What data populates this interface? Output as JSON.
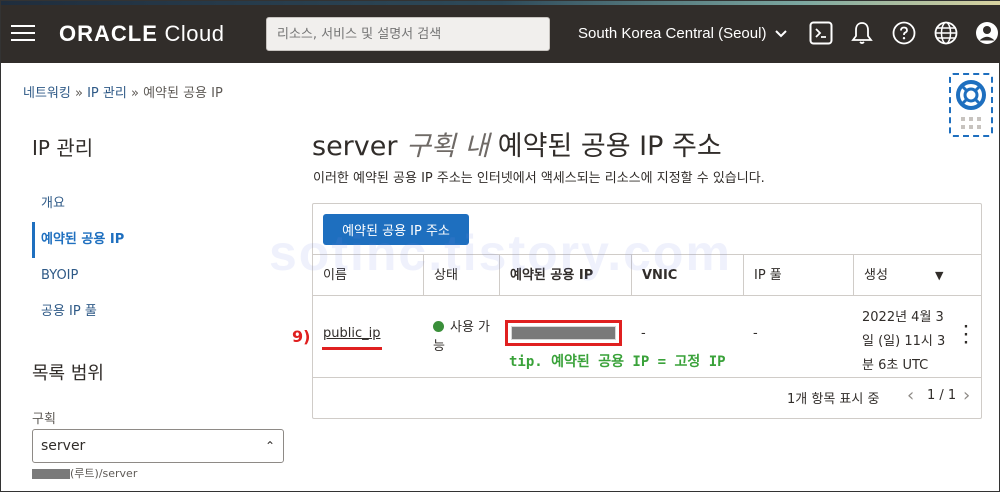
{
  "topbar": {
    "brand_oracle": "ORACLE",
    "brand_cloud": "Cloud",
    "search_placeholder": "리소스, 서비스 및 설명서 검색",
    "region": "South Korea Central (Seoul)",
    "icons": [
      "menu-icon",
      "cloud-shell-icon",
      "bell-icon",
      "help-icon",
      "globe-icon",
      "profile-icon"
    ]
  },
  "breadcrumb": {
    "item1": "네트워킹",
    "sep": "»",
    "item2": "IP 관리",
    "item3": "예약된 공용 IP"
  },
  "sidebar": {
    "title": "IP 관리",
    "items": [
      {
        "label": "개요"
      },
      {
        "label": "예약된 공용 IP",
        "active": true
      },
      {
        "label": "BYOIP"
      },
      {
        "label": "공용 IP 풀"
      }
    ],
    "scope_title": "목록 범위",
    "compartment_label": "구획",
    "compartment_value": "server",
    "compartment_path": "(루트)/server"
  },
  "main": {
    "title_prefix": "server",
    "title_italic": "구획 내",
    "title_suffix": "예약된 공용 IP 주소",
    "description": "이러한 예약된 공용 IP 주소는 인터넷에서 액세스되는 리소스에 지정할 수 있습니다.",
    "reserve_button": "예약된 공용 IP 주소"
  },
  "table": {
    "columns": [
      "이름",
      "상태",
      "예약된 공용 IP",
      "VNIC",
      "IP 풀",
      "생성"
    ],
    "rows": [
      {
        "name": "public_ip",
        "status": "사용 가능",
        "vnic": "-",
        "pool": "-",
        "created": "2022년 4월 3일 (일) 11시 3분 6초 UTC"
      }
    ],
    "footer_count": "1개 항목 표시 중",
    "page_indicator": "1 / 1"
  },
  "annotations": {
    "step": "9)",
    "tip": "tip. 예약된 공용 IP = 고정 IP"
  },
  "watermark": "sotinc.tistory.com",
  "colors": {
    "topbar_bg": "#312d2a",
    "primary": "#1e6fbf",
    "link": "#2f5a87",
    "available_green": "#3a8f3a",
    "annotation_red": "#e02020",
    "tip_green": "#3aa23a"
  }
}
